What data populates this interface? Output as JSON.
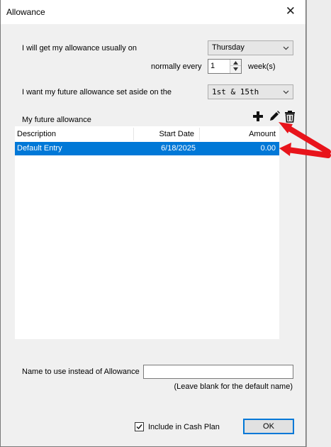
{
  "window": {
    "title": "Allowance",
    "close_glyph": "✕"
  },
  "allowance_day": {
    "label": "I will get my allowance usually on",
    "value": "Thursday"
  },
  "frequency": {
    "label": "normally every",
    "value": "1",
    "unit": "week(s)"
  },
  "set_aside": {
    "label": "I want my future allowance set aside on the",
    "value": "1st & 15th"
  },
  "future_allowance": {
    "label": "My future allowance",
    "toolbar": {
      "add_icon": "plus-icon",
      "edit_icon": "pencil-icon",
      "delete_icon": "trash-icon"
    },
    "columns": [
      "Description",
      "Start Date",
      "Amount"
    ],
    "rows": [
      {
        "description": "Default Entry",
        "start_date": "6/18/2025",
        "amount": "0.00",
        "selected": true
      }
    ]
  },
  "alias": {
    "label": "Name to use instead of Allowance",
    "value": "",
    "hint": "(Leave blank for the default name)"
  },
  "cash_plan": {
    "label": "Include in Cash Plan",
    "checked": true
  },
  "ok_button": {
    "label": "OK"
  },
  "colors": {
    "selection": "#0078d7",
    "annotation_arrow": "#e8141b",
    "dialog_bg": "#f0f0f0"
  }
}
